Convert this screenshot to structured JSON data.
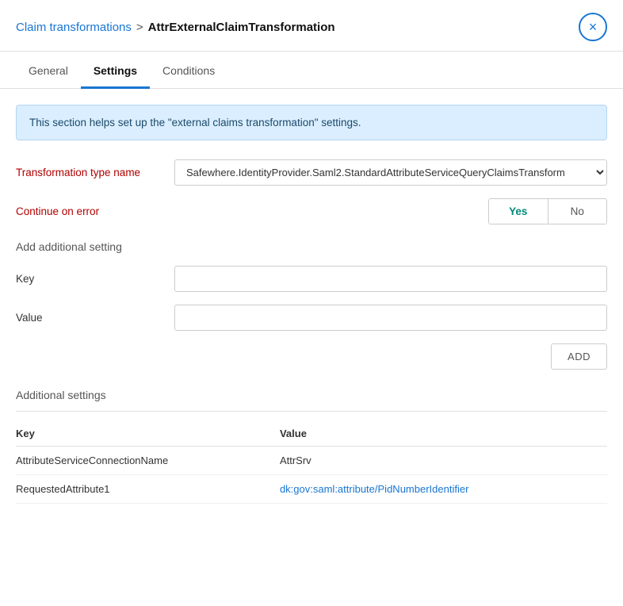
{
  "header": {
    "breadcrumb_link": "Claim transformations",
    "breadcrumb_separator": ">",
    "breadcrumb_current": "AttrExternalClaimTransformation",
    "close_label": "×"
  },
  "tabs": [
    {
      "id": "general",
      "label": "General",
      "active": false
    },
    {
      "id": "settings",
      "label": "Settings",
      "active": true
    },
    {
      "id": "conditions",
      "label": "Conditions",
      "active": false
    }
  ],
  "info_banner": "This section helps set up the \"external claims transformation\" settings.",
  "form": {
    "transformation_type_label": "Transformation type name",
    "transformation_type_value": "Safewhere.IdentityProvider.Saml2.StandardAttributeServiceQueryClaimsTransform",
    "continue_on_error_label": "Continue on error",
    "continue_on_error_yes": "Yes",
    "continue_on_error_no": "No",
    "add_additional_setting_title": "Add additional setting",
    "key_label": "Key",
    "key_value": "",
    "key_placeholder": "",
    "value_label": "Value",
    "value_value": "",
    "value_placeholder": "",
    "add_button": "ADD"
  },
  "additional_settings": {
    "title": "Additional settings",
    "columns": [
      "Key",
      "Value"
    ],
    "rows": [
      {
        "key": "AttributeServiceConnectionName",
        "value": "AttrSrv",
        "value_is_link": false
      },
      {
        "key": "RequestedAttribute1",
        "value": "dk:gov:saml:attribute/PidNumberIdentifier",
        "value_is_link": true
      }
    ]
  }
}
